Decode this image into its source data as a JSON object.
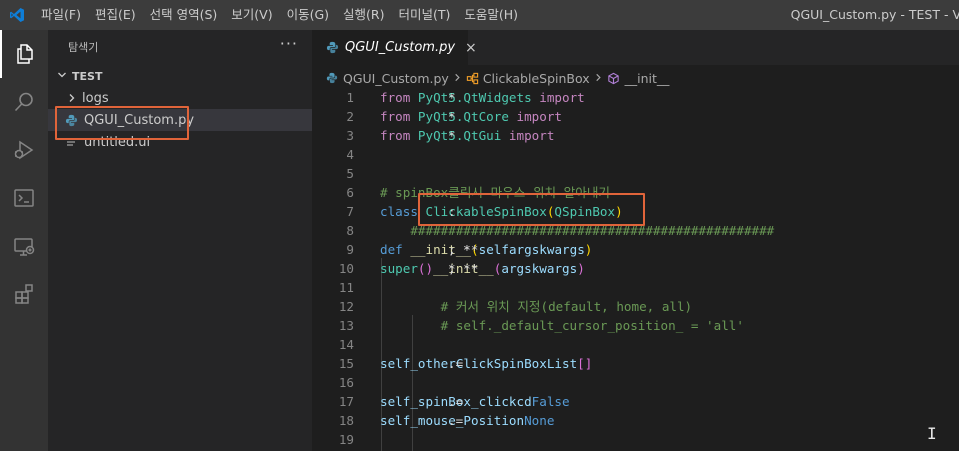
{
  "titlebar": {
    "menu": [
      "파일(F)",
      "편집(E)",
      "선택 영역(S)",
      "보기(V)",
      "이동(G)",
      "실행(R)",
      "터미널(T)",
      "도움말(H)"
    ],
    "window_title": "QGUI_Custom.py - TEST - V"
  },
  "activity": [
    "files-icon",
    "search-icon",
    "debug-icon",
    "terminal-icon",
    "remote-explorer-icon",
    "extensions-icon"
  ],
  "sidebar": {
    "title": "탐색기",
    "more": "···",
    "section": "TEST",
    "items": [
      {
        "label": "logs",
        "type": "folder"
      },
      {
        "label": "QGUI_Custom.py",
        "type": "python"
      },
      {
        "label": "untitled.ui",
        "type": "file"
      }
    ]
  },
  "editor": {
    "tab_label": "QGUI_Custom.py",
    "tab_close": "×",
    "breadcrumb": {
      "file": "QGUI_Custom.py",
      "class": "ClickableSpinBox",
      "method": "__init__"
    },
    "lines": [
      {
        "n": "1",
        "parts": [
          [
            "kw",
            "from "
          ],
          [
            "mod",
            "PyQt5.QtWidgets"
          ],
          [
            "kw",
            " import "
          ],
          [
            "txt",
            "*"
          ]
        ]
      },
      {
        "n": "2",
        "parts": [
          [
            "kw",
            "from "
          ],
          [
            "mod",
            "PyQt5.QtCore"
          ],
          [
            "kw",
            " import "
          ],
          [
            "txt",
            "*"
          ]
        ]
      },
      {
        "n": "3",
        "parts": [
          [
            "kw",
            "from "
          ],
          [
            "mod",
            "PyQt5.QtGui"
          ],
          [
            "kw",
            " import "
          ],
          [
            "txt",
            "*"
          ]
        ]
      },
      {
        "n": "4",
        "parts": []
      },
      {
        "n": "5",
        "parts": []
      },
      {
        "n": "6",
        "parts": [
          [
            "cm",
            "# spinBox클릭시 마우스 위치 알아내기"
          ]
        ]
      },
      {
        "n": "7",
        "parts": [
          [
            "kwb",
            "class "
          ],
          [
            "cls",
            "ClickableSpinBox"
          ],
          [
            "br",
            "("
          ],
          [
            "cls",
            "QSpinBox"
          ],
          [
            "br",
            ")"
          ],
          [
            "txt",
            ":"
          ]
        ]
      },
      {
        "n": "8",
        "parts": [
          [
            "cm",
            "    ################################################"
          ]
        ]
      },
      {
        "n": "9",
        "parts": [
          [
            "txt",
            "    "
          ],
          [
            "kwb",
            "def "
          ],
          [
            "fn",
            "__init__"
          ],
          [
            "br",
            "("
          ],
          [
            "var",
            "self"
          ],
          [
            "txt",
            ", *"
          ],
          [
            "var",
            "args"
          ],
          [
            "txt",
            ", **"
          ],
          [
            "var",
            "kwargs"
          ],
          [
            "br",
            ")"
          ],
          [
            "txt",
            ":"
          ]
        ]
      },
      {
        "n": "10",
        "parts": [
          [
            "txt",
            "        "
          ],
          [
            "mod",
            "super"
          ],
          [
            "br2",
            "()"
          ],
          [
            "txt",
            "."
          ],
          [
            "fn",
            "__init__"
          ],
          [
            "br2",
            "("
          ],
          [
            "txt",
            "*"
          ],
          [
            "var",
            "args"
          ],
          [
            "txt",
            ", **"
          ],
          [
            "var",
            "kwargs"
          ],
          [
            "br2",
            ")"
          ]
        ]
      },
      {
        "n": "11",
        "parts": []
      },
      {
        "n": "12",
        "parts": [
          [
            "cm",
            "        # 커서 위치 지정(default, home, all)"
          ]
        ]
      },
      {
        "n": "13",
        "parts": [
          [
            "cm",
            "        # self._default_cursor_position_ = 'all'"
          ]
        ]
      },
      {
        "n": "14",
        "parts": []
      },
      {
        "n": "15",
        "parts": [
          [
            "txt",
            "        "
          ],
          [
            "var",
            "self"
          ],
          [
            "txt",
            "."
          ],
          [
            "var",
            "_otherClickSpinBoxList"
          ],
          [
            "txt",
            " = "
          ],
          [
            "br2",
            "[]"
          ]
        ]
      },
      {
        "n": "16",
        "parts": []
      },
      {
        "n": "17",
        "parts": [
          [
            "txt",
            "        "
          ],
          [
            "var",
            "self"
          ],
          [
            "txt",
            "."
          ],
          [
            "var",
            "_spinBox_clickcd"
          ],
          [
            "txt",
            " = "
          ],
          [
            "kwb",
            "False"
          ]
        ]
      },
      {
        "n": "18",
        "parts": [
          [
            "txt",
            "        "
          ],
          [
            "var",
            "self"
          ],
          [
            "txt",
            "."
          ],
          [
            "var",
            "_mouse_Position"
          ],
          [
            "txt",
            " = "
          ],
          [
            "kwb",
            "None"
          ]
        ]
      },
      {
        "n": "19",
        "parts": []
      }
    ]
  },
  "colors": {
    "highlight": "#e0643a",
    "accent": "#007acc",
    "python_icon": "#519aba"
  }
}
